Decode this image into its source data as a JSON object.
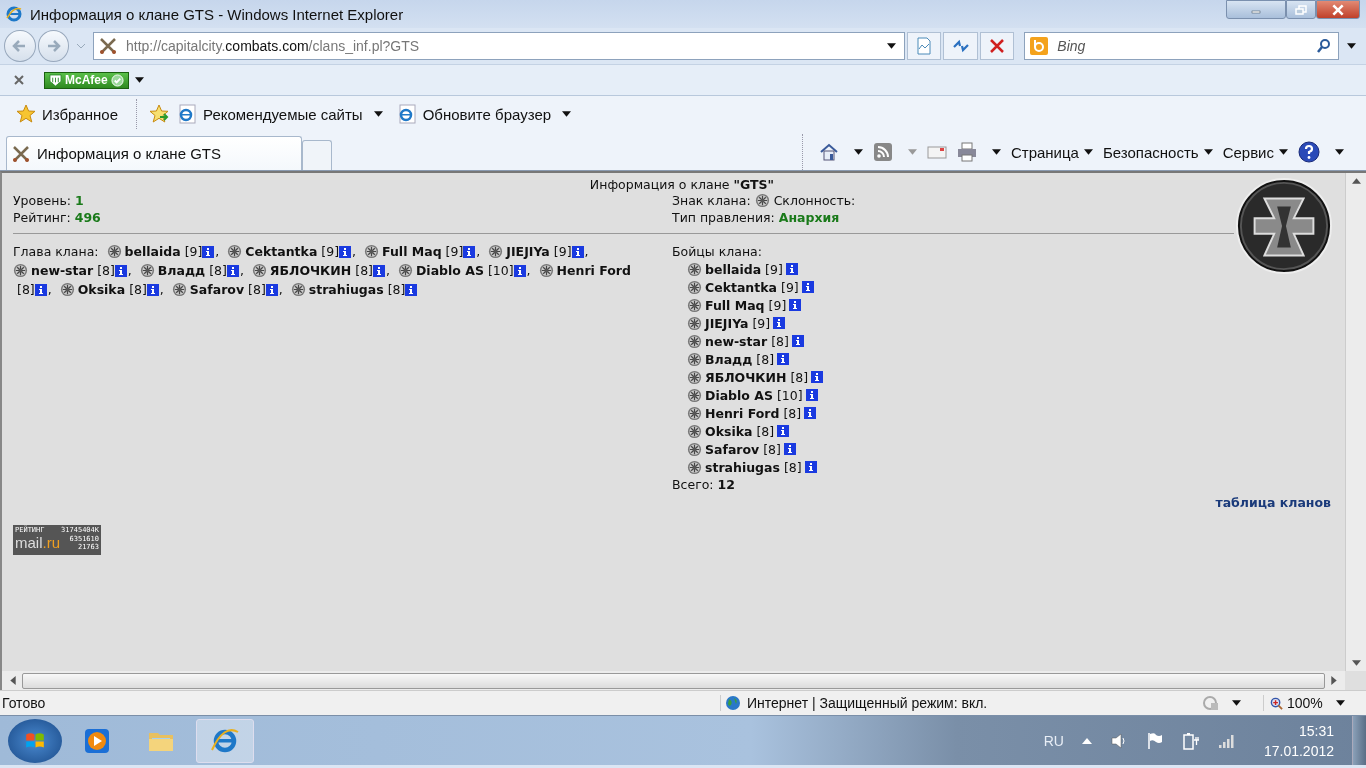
{
  "window": {
    "title": "Информация о клане GTS - Windows Internet Explorer"
  },
  "address_bar": {
    "url_parts": [
      {
        "text": "http://capitalcity.",
        "kind": "dim"
      },
      {
        "text": "combats.com",
        "kind": "host"
      },
      {
        "text": "/clans_inf.pl?GTS",
        "kind": "dim"
      }
    ],
    "search_placeholder": "Bing"
  },
  "addon_bar": {
    "addon": "McAfee"
  },
  "favorites_bar": {
    "favorites": "Избранное",
    "links": [
      "Рекомендуемые сайты",
      "Обновите браузер"
    ]
  },
  "tabs": [
    {
      "label": "Информация о клане GTS",
      "selected": true
    }
  ],
  "command_bar": [
    "Страница",
    "Безопасность",
    "Сервис"
  ],
  "page": {
    "heading": "Информация о клане **\"GTS\"**",
    "stats": [
      {
        "label": "Уровень:",
        "value": "1"
      },
      {
        "label": "Рейтинг:",
        "value": "496"
      }
    ],
    "sign_label": "Знак клана:",
    "alignment_label": "Склонность:",
    "government": {
      "label": "Тип правления:",
      "value": "Анархия"
    },
    "head": {
      "label": "Глава клана:",
      "members": [
        {
          "name": "bellaida",
          "level": "[9]",
          "separator": ","
        },
        {
          "name": "Cektantka",
          "level": "[9]",
          "separator": ","
        },
        {
          "name": "Full Maq",
          "level": "[9]",
          "separator": ","
        },
        {
          "name": "JIEJIYa",
          "level": "[9]",
          "separator": ","
        },
        {
          "name": "new-star",
          "level": "[8]",
          "separator": ","
        },
        {
          "name": "Владд",
          "level": "[8]",
          "separator": ","
        },
        {
          "name": "ЯБЛОЧКИН",
          "level": "[8]",
          "separator": ","
        },
        {
          "name": "Diablo AS",
          "level": "[10]",
          "separator": ","
        },
        {
          "name": "Henri Ford",
          "level": "[8]",
          "separator": ","
        },
        {
          "name": "Oksika",
          "level": "[8]",
          "separator": ","
        },
        {
          "name": "Safarov",
          "level": "[8]",
          "separator": ","
        },
        {
          "name": "strahiugas",
          "level": "[8]"
        }
      ]
    },
    "fighters": {
      "label": "Бойцы клана:",
      "members": [
        {
          "name": "bellaida",
          "level": "[9]"
        },
        {
          "name": "Cektantka",
          "level": "[9]"
        },
        {
          "name": "Full Maq",
          "level": "[9]"
        },
        {
          "name": "JIEJIYa",
          "level": "[9]"
        },
        {
          "name": "new-star",
          "level": "[8]"
        },
        {
          "name": "Владд",
          "level": "[8]"
        },
        {
          "name": "ЯБЛОЧКИН",
          "level": "[8]"
        },
        {
          "name": "Diablo AS",
          "level": "[10]"
        },
        {
          "name": "Henri Ford",
          "level": "[8]"
        },
        {
          "name": "Oksika",
          "level": "[8]"
        },
        {
          "name": "Safarov",
          "level": "[8]"
        },
        {
          "name": "strahiugas",
          "level": "[8]"
        }
      ],
      "total_label": "Всего:",
      "total": "12"
    },
    "clan_table_link": "таблица кланов",
    "counter": {
      "title": "РЕЙТИНГ",
      "value_1": "31745404K",
      "logo_parts": [
        "mail",
        ".ru"
      ],
      "value_2": "6351610",
      "value_3": "21763"
    }
  },
  "status_bar": {
    "status": "Готово",
    "zone": "Интернет | Защищенный режим: вкл.",
    "zoom": "100%"
  },
  "taskbar": {
    "language": "RU",
    "time": "15:31",
    "date": "17.01.2012"
  }
}
